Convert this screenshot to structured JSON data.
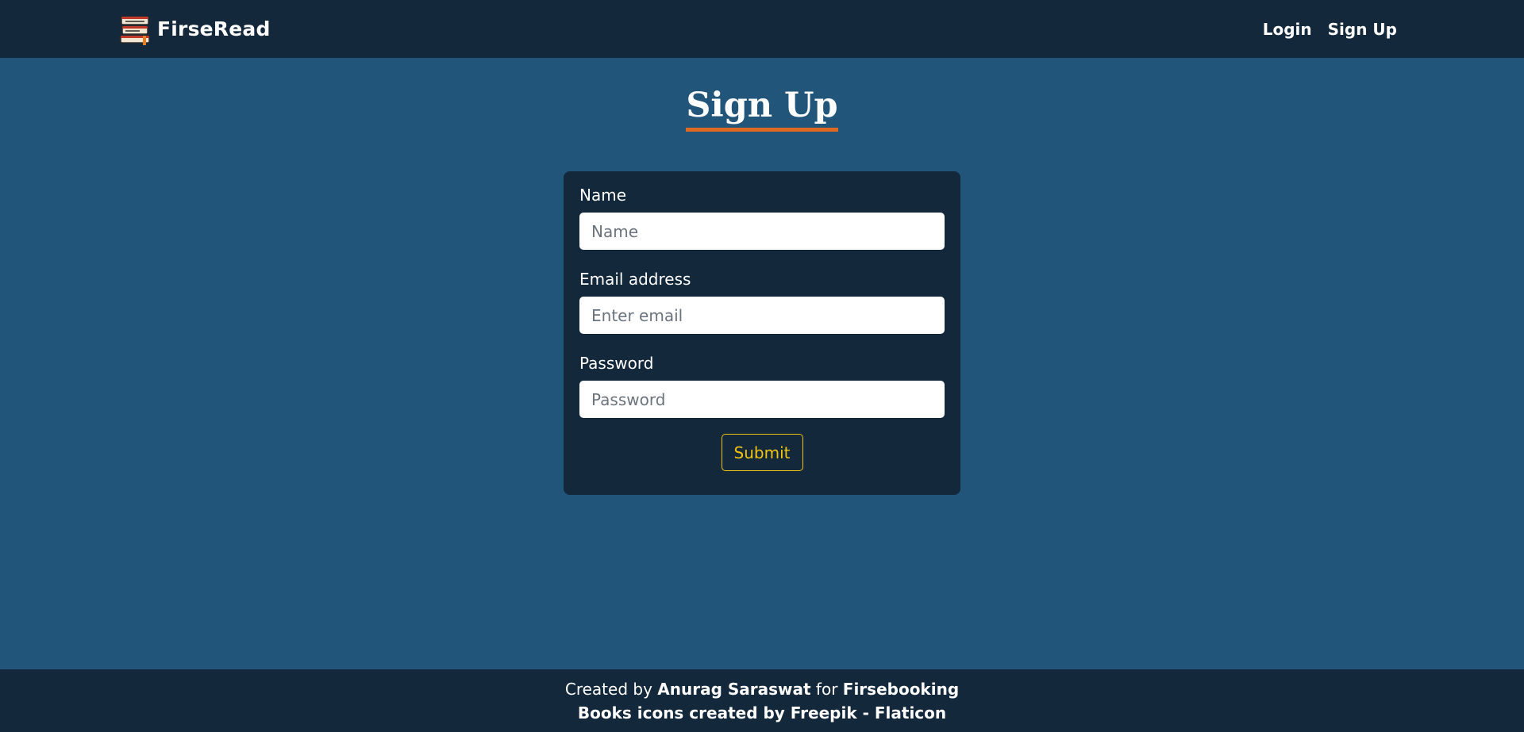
{
  "navbar": {
    "brand_name": "FirseRead",
    "brand_icon": "books-stack-icon",
    "links": [
      {
        "label": "Login"
      },
      {
        "label": "Sign Up"
      }
    ]
  },
  "page": {
    "title": "Sign Up",
    "title_underline_color": "#e06a22"
  },
  "form": {
    "name": {
      "label": "Name",
      "placeholder": "Name",
      "value": ""
    },
    "email": {
      "label": "Email address",
      "placeholder": "Enter email",
      "value": ""
    },
    "password": {
      "label": "Password",
      "placeholder": "Password",
      "value": ""
    },
    "submit_label": "Submit",
    "submit_color": "#f1c40f"
  },
  "footer": {
    "line1": {
      "prefix": "Created by",
      "author": "Anurag Saraswat",
      "middle": "for",
      "project": "Firsebooking"
    },
    "line2": "Books icons created by Freepik - Flaticon"
  },
  "colors": {
    "background": "#22557a",
    "navbar": "#13283b",
    "card": "#13283b",
    "footer": "#13283b"
  }
}
